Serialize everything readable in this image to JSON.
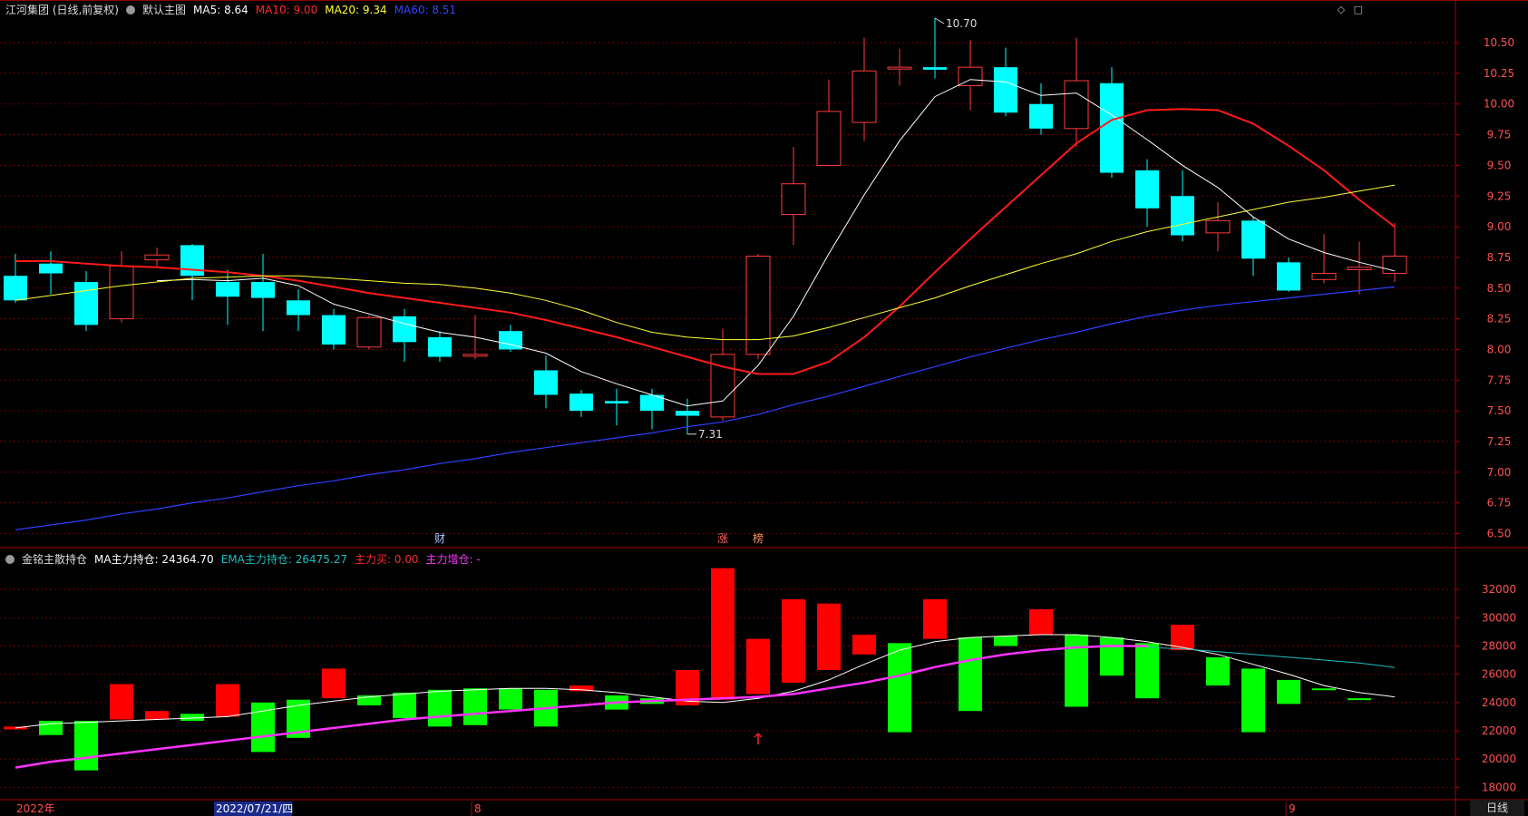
{
  "main_header": {
    "title": "江河集团 (日线,前复权)",
    "template": "默认主图",
    "ma5": "MA5: 8.64",
    "ma10": "MA10: 9.00",
    "ma20": "MA20: 9.34",
    "ma60": "MA60: 8.51"
  },
  "sub_header": {
    "title": "金铭主散持仓",
    "ma_main": "MA主力持仓: 24364.70",
    "ema_main": "EMA主力持仓: 26475.27",
    "main_buy": "主力买: 0.00",
    "main_add": "主力增仓: -"
  },
  "bottom_right_label": "日线",
  "colors": {
    "up": "#ff3b3b",
    "down": "#00ffff",
    "ma5": "#ffffff",
    "ma10": "#ff1a1a",
    "ma20": "#ffff33",
    "ma60": "#2f3fff",
    "bar_up": "#ff0000",
    "bar_down": "#00ff00",
    "sub_ma": "#ffffff",
    "sub_ema": "#ff33ff",
    "sub_ema2": "#1fbfbf",
    "grid": "#8b0000"
  },
  "chart_data": [
    {
      "type": "candlestick",
      "title": "江河集团 (日线,前复权)",
      "ylim": [
        6.4,
        10.7
      ],
      "y_ticks": [
        "10.50",
        "10.25",
        "10.00",
        "9.75",
        "9.50",
        "9.25",
        "9.00",
        "8.75",
        "8.50",
        "8.25",
        "8.00",
        "7.75",
        "7.50",
        "7.25",
        "7.00",
        "6.75",
        "6.50"
      ],
      "annotations": {
        "high": "10.70",
        "low": "7.31"
      },
      "event_markers": [
        "财",
        "涨",
        "榜"
      ],
      "x_labels": [
        "2022年",
        "2022/07/21/四",
        "8",
        "9"
      ],
      "candles": [
        [
          8.6,
          8.4,
          8.78,
          8.38
        ],
        [
          8.7,
          8.62,
          8.8,
          8.45
        ],
        [
          8.55,
          8.2,
          8.64,
          8.15
        ],
        [
          8.25,
          8.68,
          8.8,
          8.22
        ],
        [
          8.73,
          8.77,
          8.83,
          8.68
        ],
        [
          8.85,
          8.6,
          8.86,
          8.4
        ],
        [
          8.55,
          8.43,
          8.65,
          8.2
        ],
        [
          8.55,
          8.42,
          8.78,
          8.15
        ],
        [
          8.4,
          8.28,
          8.49,
          8.15
        ],
        [
          8.28,
          8.04,
          8.33,
          8.0
        ],
        [
          8.02,
          8.26,
          8.28,
          8.0
        ],
        [
          8.27,
          8.06,
          8.33,
          7.9
        ],
        [
          8.1,
          7.94,
          8.15,
          7.9
        ],
        [
          7.95,
          7.96,
          8.28,
          7.92
        ],
        [
          8.15,
          8.0,
          8.2,
          7.98
        ],
        [
          7.83,
          7.63,
          7.95,
          7.52
        ],
        [
          7.64,
          7.5,
          7.67,
          7.45
        ],
        [
          7.58,
          7.56,
          7.68,
          7.38
        ],
        [
          7.63,
          7.5,
          7.68,
          7.35
        ],
        [
          7.5,
          7.46,
          7.6,
          7.31
        ],
        [
          7.45,
          7.96,
          8.17,
          7.42
        ],
        [
          7.96,
          8.76,
          8.78,
          7.92
        ],
        [
          9.1,
          9.35,
          9.65,
          8.85
        ],
        [
          9.5,
          9.94,
          10.2,
          9.5
        ],
        [
          9.85,
          10.27,
          10.54,
          9.7
        ],
        [
          10.3,
          10.3,
          10.45,
          10.15
        ],
        [
          10.3,
          10.28,
          10.7,
          10.21
        ],
        [
          10.15,
          10.3,
          10.52,
          9.95
        ],
        [
          10.3,
          9.93,
          10.46,
          9.9
        ],
        [
          10.0,
          9.8,
          10.17,
          9.75
        ],
        [
          9.8,
          10.19,
          10.54,
          9.65
        ],
        [
          10.17,
          9.44,
          10.3,
          9.4
        ],
        [
          9.46,
          9.15,
          9.55,
          9.0
        ],
        [
          9.25,
          8.93,
          9.46,
          8.88
        ],
        [
          8.95,
          9.05,
          9.2,
          8.8
        ],
        [
          9.05,
          8.74,
          9.08,
          8.6
        ],
        [
          8.71,
          8.48,
          8.75,
          8.47
        ],
        [
          8.57,
          8.62,
          8.94,
          8.54
        ],
        [
          8.65,
          8.67,
          8.88,
          8.45
        ],
        [
          8.62,
          8.76,
          9.03,
          8.55
        ]
      ],
      "series": [
        {
          "name": "MA5",
          "values": [
            null,
            null,
            null,
            null,
            8.56,
            8.57,
            8.56,
            8.58,
            8.52,
            8.37,
            8.29,
            8.21,
            8.14,
            8.1,
            8.04,
            7.97,
            7.82,
            7.72,
            7.63,
            7.54,
            7.58,
            7.87,
            8.27,
            8.78,
            9.26,
            9.7,
            10.06,
            10.2,
            10.18,
            10.07,
            10.09,
            9.91,
            9.71,
            9.5,
            9.32,
            9.08,
            8.9,
            8.79,
            8.71,
            8.64
          ]
        },
        {
          "name": "MA10",
          "values": [
            8.72,
            8.72,
            8.7,
            8.68,
            8.67,
            8.65,
            8.63,
            8.6,
            8.56,
            8.51,
            8.46,
            8.42,
            8.38,
            8.34,
            8.3,
            8.24,
            8.17,
            8.1,
            8.02,
            7.94,
            7.86,
            7.8,
            7.8,
            7.9,
            8.1,
            8.35,
            8.63,
            8.9,
            9.16,
            9.42,
            9.68,
            9.87,
            9.95,
            9.96,
            9.95,
            9.84,
            9.66,
            9.46,
            9.22,
            9.0
          ]
        },
        {
          "name": "MA20",
          "values": [
            8.4,
            8.44,
            8.48,
            8.52,
            8.55,
            8.58,
            8.59,
            8.6,
            8.6,
            8.58,
            8.56,
            8.54,
            8.53,
            8.5,
            8.46,
            8.4,
            8.32,
            8.22,
            8.14,
            8.1,
            8.08,
            8.08,
            8.11,
            8.18,
            8.26,
            8.34,
            8.42,
            8.52,
            8.61,
            8.7,
            8.78,
            8.88,
            8.96,
            9.02,
            9.08,
            9.14,
            9.2,
            9.24,
            9.29,
            9.34
          ]
        },
        {
          "name": "MA60",
          "values": [
            6.53,
            6.57,
            6.61,
            6.66,
            6.7,
            6.75,
            6.79,
            6.84,
            6.89,
            6.93,
            6.98,
            7.02,
            7.07,
            7.11,
            7.16,
            7.2,
            7.24,
            7.28,
            7.32,
            7.37,
            7.41,
            7.47,
            7.55,
            7.62,
            7.7,
            7.78,
            7.86,
            7.94,
            8.01,
            8.08,
            8.14,
            8.21,
            8.27,
            8.32,
            8.36,
            8.39,
            8.42,
            8.45,
            8.48,
            8.51
          ]
        }
      ]
    },
    {
      "type": "bar",
      "title": "金铭主散持仓",
      "ylim": [
        17000,
        33800
      ],
      "y_ticks": [
        "32000",
        "30000",
        "28000",
        "26000",
        "24000",
        "22000",
        "20000",
        "18000"
      ],
      "bars": [
        [
          22100,
          22300
        ],
        [
          22700,
          21700
        ],
        [
          22700,
          19200
        ],
        [
          22800,
          25300
        ],
        [
          22800,
          23400
        ],
        [
          23200,
          22700
        ],
        [
          23000,
          25300
        ],
        [
          24000,
          20500
        ],
        [
          24200,
          21500
        ],
        [
          24300,
          26400
        ],
        [
          24500,
          23800
        ],
        [
          24700,
          22900
        ],
        [
          24900,
          22300
        ],
        [
          25000,
          22400
        ],
        [
          25000,
          23500
        ],
        [
          24900,
          22300
        ],
        [
          24800,
          25200
        ],
        [
          24500,
          23500
        ],
        [
          24300,
          23900
        ],
        [
          23800,
          26300
        ],
        [
          24200,
          33500
        ],
        [
          24600,
          28500
        ],
        [
          25400,
          31300
        ],
        [
          26300,
          31000
        ],
        [
          27400,
          28800
        ],
        [
          28200,
          21900
        ],
        [
          28500,
          31300
        ],
        [
          28600,
          23400
        ],
        [
          28700,
          28000
        ],
        [
          28800,
          30600
        ],
        [
          28800,
          23700
        ],
        [
          28600,
          25900
        ],
        [
          28200,
          24300
        ],
        [
          27700,
          29500
        ],
        [
          27200,
          25200
        ],
        [
          26400,
          21900
        ],
        [
          25600,
          23900
        ],
        [
          25000,
          24900
        ],
        [
          24300,
          24200
        ]
      ],
      "series": [
        {
          "name": "MA主力持仓",
          "values": [
            22200,
            22500,
            22600,
            22700,
            22800,
            22900,
            23000,
            23400,
            23800,
            24100,
            24400,
            24600,
            24800,
            24900,
            25000,
            25000,
            24900,
            24700,
            24400,
            24100,
            24000,
            24300,
            24800,
            25600,
            26700,
            27700,
            28300,
            28600,
            28700,
            28800,
            28800,
            28600,
            28300,
            27900,
            27400,
            26700,
            26000,
            25200,
            24700,
            24400
          ]
        },
        {
          "name": "",
          "values": [
            19400,
            19800,
            20100,
            20400,
            20700,
            21000,
            21300,
            21600,
            21900,
            22200,
            22500,
            22800,
            23000,
            23200,
            23400,
            23600,
            23800,
            24000,
            24100,
            24200,
            24300,
            24400,
            24600,
            25000,
            25400,
            25900,
            26500,
            27000,
            27400,
            27700,
            27900,
            28000,
            28000,
            null,
            null,
            null,
            null,
            null,
            null,
            null
          ]
        },
        {
          "name": "EMA主力持仓",
          "values": [
            null,
            null,
            null,
            null,
            null,
            null,
            null,
            null,
            null,
            null,
            null,
            null,
            null,
            null,
            null,
            null,
            null,
            null,
            null,
            null,
            null,
            null,
            null,
            null,
            null,
            null,
            null,
            null,
            null,
            null,
            null,
            null,
            27900,
            27800,
            27600,
            27400,
            27200,
            27000,
            26800,
            26475
          ]
        }
      ]
    }
  ]
}
